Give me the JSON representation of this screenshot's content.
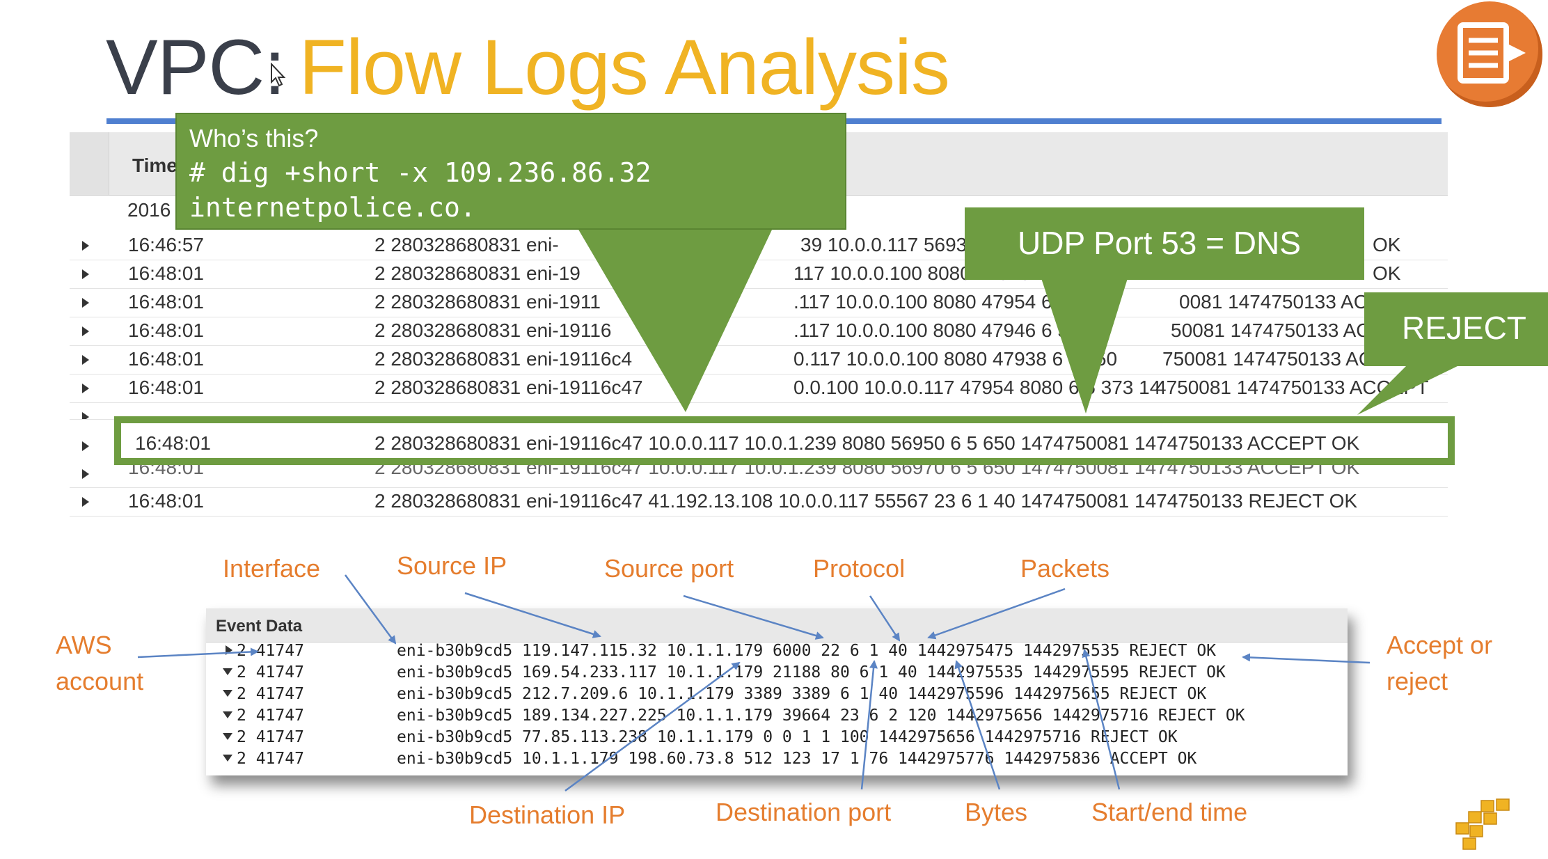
{
  "slide": {
    "title_prefix": "VPC:",
    "title_main": "Flow Logs Analysis",
    "icon": "flow-logs-icon",
    "accent_color": "#f0b323",
    "callout_color": "#6e9c41"
  },
  "logs_table": {
    "time_header": "Time",
    "date_fragment": "2016",
    "rows": [
      {
        "time": "16:46:57",
        "message": "2 280328680831 eni-",
        "tail": "39 10.0.0.117 56934 8080",
        "status": "OK"
      },
      {
        "time": "16:48:01",
        "message": "2 280328680831 eni-19",
        "tail": "117 10.0.0.100 8080 47928",
        "status": "OK"
      },
      {
        "time": "16:48:01",
        "message": "2 280328680831 eni-1911",
        "tail": ".117 10.0.0.100 8080 47954 6 5 650",
        "tail2": "0081 1474750133 ACCEPT"
      },
      {
        "time": "16:48:01",
        "message": "2 280328680831 eni-19116",
        "tail": ".117 10.0.0.100 8080 47946 6 5 650",
        "tail2": "50081 1474750133 ACCEPT"
      },
      {
        "time": "16:48:01",
        "message": "2 280328680831 eni-19116c4",
        "tail": "0.117 10.0.0.100 8080 47938 6 5 650",
        "tail2": "750081 1474750133 ACCEPT"
      },
      {
        "time": "16:48:01",
        "message": "2 280328680831 eni-19116c47",
        "tail": "0.0.100 10.0.0.117 47954 8080 6 5 373 14",
        "tail2": "4750081 1474750133 ACCEPT"
      }
    ],
    "highlighted": {
      "time": "16:48:01",
      "message": "2 280328680831 eni-19116c47 10.0.0.117 10.0.1.239 8080 56950 6 5 650 1474750081 1474750133 ACCEPT OK"
    },
    "cut_row_time": "16:48:01",
    "cut_row_message": "2 280328680831 eni-19116c47 10.0.0.117 10.0.1.239 8080 56970 6 5 650 1474750081 1474750133 ACCEPT OK",
    "last_row": {
      "time": "16:48:01",
      "message": "2 280328680831 eni-19116c47 41.192.13.108 10.0.0.117 55567 23 6 1 40 1474750081 1474750133 REJECT OK"
    }
  },
  "callouts": {
    "whois": {
      "line1": "Who’s this?",
      "line2": "# dig +short -x 109.236.86.32",
      "line3": "internetpolice.co."
    },
    "udp": "UDP Port 53 = DNS",
    "reject": "REJECT"
  },
  "event_table": {
    "header": "Event Data",
    "rows": [
      {
        "acct": "2 41747",
        "rest": "eni-b30b9cd5 119.147.115.32 10.1.1.179 6000 22 6 1 40 1442975475 1442975535 REJECT OK"
      },
      {
        "acct": "2 41747",
        "rest": "eni-b30b9cd5 169.54.233.117 10.1.1.179 21188 80 6 1 40 1442975535 1442975595 REJECT OK"
      },
      {
        "acct": "2 41747",
        "rest": "eni-b30b9cd5 212.7.209.6 10.1.1.179 3389 3389 6 1 40 1442975596 1442975655 REJECT OK"
      },
      {
        "acct": "2 41747",
        "rest": "eni-b30b9cd5 189.134.227.225 10.1.1.179 39664 23 6 2 120 1442975656 1442975716 REJECT OK"
      },
      {
        "acct": "2 41747",
        "rest": "eni-b30b9cd5 77.85.113.238 10.1.1.179 0 0 1 1 100 1442975656 1442975716 REJECT OK"
      },
      {
        "acct": "2 41747",
        "rest": "eni-b30b9cd5 10.1.1.179 198.60.73.8 512 123 17 1 76 1442975776 1442975836 ACCEPT OK"
      }
    ]
  },
  "labels": {
    "interface": "Interface",
    "source_ip": "Source IP",
    "source_port": "Source port",
    "protocol": "Protocol",
    "packets": "Packets",
    "aws_line1": "AWS",
    "aws_line2": "account",
    "accept_line1": "Accept or",
    "accept_line2": "reject",
    "destination_ip": "Destination IP",
    "destination_port": "Destination port",
    "bytes": "Bytes",
    "start_end_time": "Start/end time"
  }
}
